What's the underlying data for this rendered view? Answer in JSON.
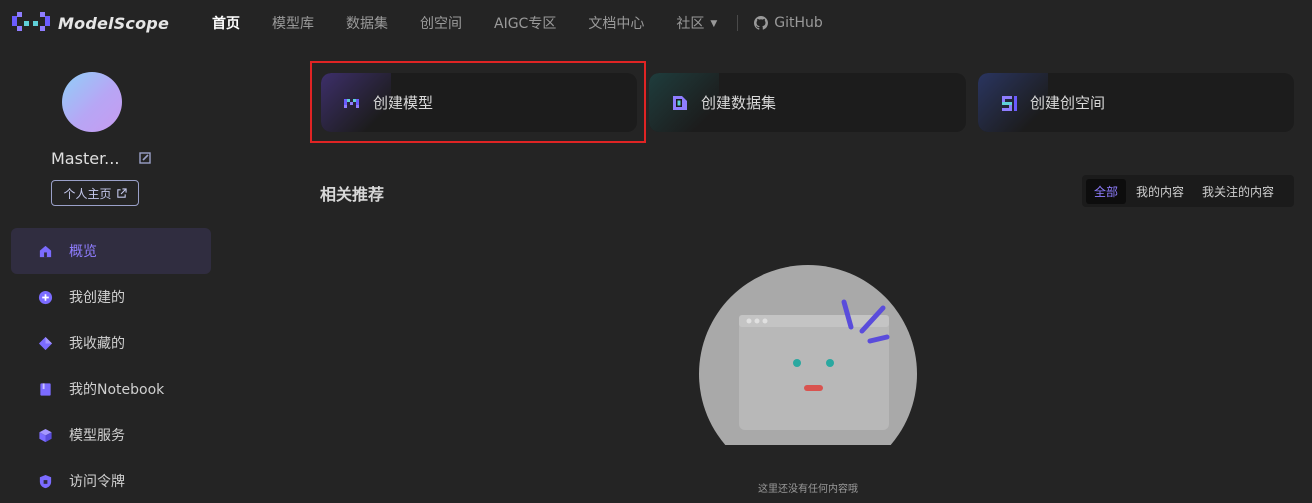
{
  "brand": {
    "logo_text": "ModelScope"
  },
  "nav": {
    "items": [
      "首页",
      "模型库",
      "数据集",
      "创空间",
      "AIGC专区",
      "文档中心",
      "社区"
    ],
    "github": "GitHub"
  },
  "user": {
    "name": "Master...",
    "home_button": "个人主页"
  },
  "sidebar": {
    "items": [
      {
        "label": "概览",
        "icon": "home-icon"
      },
      {
        "label": "我创建的",
        "icon": "plus-circle-icon"
      },
      {
        "label": "我收藏的",
        "icon": "star-diamond-icon"
      },
      {
        "label": "我的Notebook",
        "icon": "notebook-icon"
      },
      {
        "label": "模型服务",
        "icon": "cube-icon"
      },
      {
        "label": "访问令牌",
        "icon": "token-shield-icon"
      }
    ]
  },
  "create_cards": [
    {
      "label": "创建模型",
      "icon": "model-icon"
    },
    {
      "label": "创建数据集",
      "icon": "dataset-icon"
    },
    {
      "label": "创建创空间",
      "icon": "studio-icon"
    }
  ],
  "recommend": {
    "title": "相关推荐",
    "filters": [
      "全部",
      "我的内容",
      "我关注的内容"
    ],
    "empty_text": "这里还没有任何内容哦"
  },
  "colors": {
    "accent": "#8f7dff",
    "highlight": "#e02424"
  }
}
